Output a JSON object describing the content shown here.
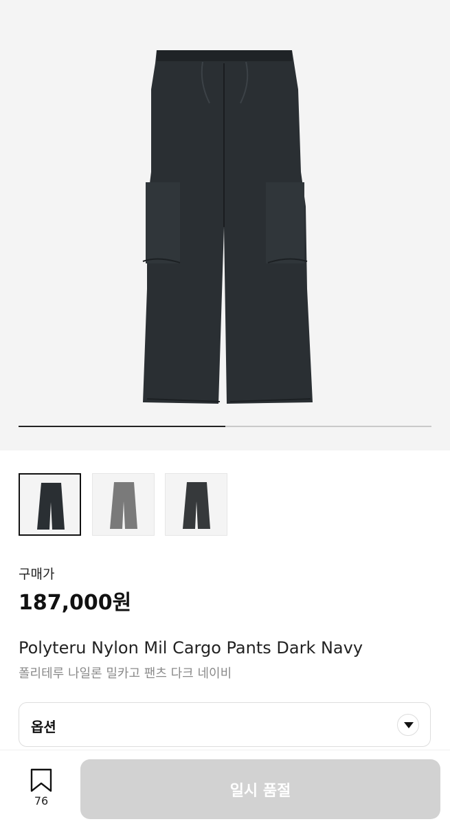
{
  "gallery": {
    "progress_fraction": 0.5,
    "thumbnails": [
      {
        "name": "dark navy",
        "color": "#2a2f33",
        "selected": true
      },
      {
        "name": "gray",
        "color": "#7a7a7a",
        "selected": false
      },
      {
        "name": "charcoal",
        "color": "#36393b",
        "selected": false
      }
    ]
  },
  "product": {
    "price_label": "구매가",
    "price": "187,000원",
    "title_en": "Polyteru Nylon Mil Cargo Pants Dark Navy",
    "title_ko": "폴리테루 나일론 밀카고 팬츠 다크 네이비"
  },
  "option": {
    "label": "옵션"
  },
  "bottom_bar": {
    "bookmark_count": "76",
    "soldout_label": "일시 품절"
  },
  "colors": {
    "pants": "#2a2f33",
    "background": "#f4f4f4",
    "disabled_button": "#d2d2d2"
  }
}
